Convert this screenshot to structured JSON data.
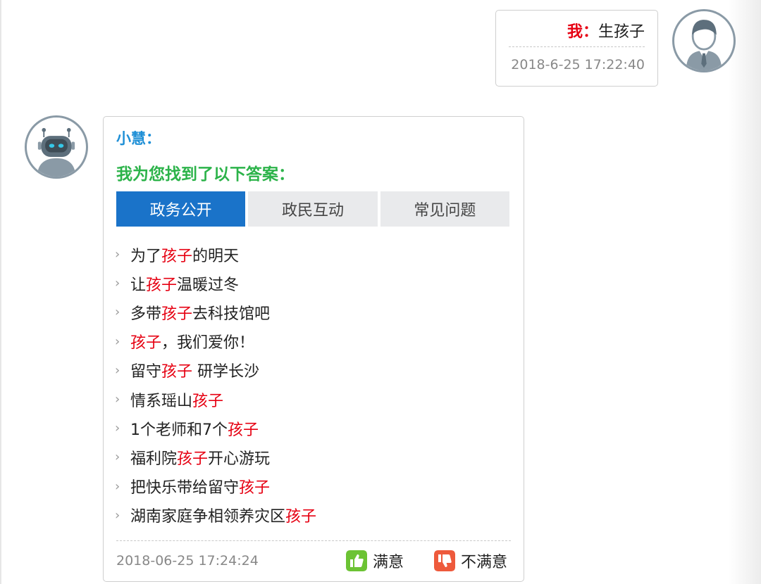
{
  "user_message": {
    "sender": "我：",
    "text": "生孩子",
    "time": "2018-6-25 17:22:40"
  },
  "bot_message": {
    "sender": "小慧：",
    "intro": "我为您找到了以下答案：",
    "tabs": [
      {
        "label": "政务公开",
        "active": true
      },
      {
        "label": "政民互动",
        "active": false
      },
      {
        "label": "常见问题",
        "active": false
      }
    ],
    "results": [
      {
        "before": "为了",
        "keyword": "孩子",
        "after": "的明天"
      },
      {
        "before": "让",
        "keyword": "孩子",
        "after": "温暖过冬"
      },
      {
        "before": "多带",
        "keyword": "孩子",
        "after": "去科技馆吧"
      },
      {
        "before": "",
        "keyword": "孩子",
        "after": "，我们爱你！"
      },
      {
        "before": "留守",
        "keyword": "孩子",
        "after": " 研学长沙"
      },
      {
        "before": "情系瑶山",
        "keyword": "孩子",
        "after": ""
      },
      {
        "before": "1个老师和7个",
        "keyword": "孩子",
        "after": ""
      },
      {
        "before": "福利院",
        "keyword": "孩子",
        "after": "开心游玩"
      },
      {
        "before": "把快乐带给留守",
        "keyword": "孩子",
        "after": ""
      },
      {
        "before": "湖南家庭争相领养灾区",
        "keyword": "孩子",
        "after": ""
      }
    ],
    "time": "2018-06-25 17:24:24",
    "satisfied_label": "满意",
    "unsatisfied_label": "不满意"
  },
  "icons": {
    "user_avatar": "user-avatar-icon",
    "bot_avatar": "robot-avatar-icon",
    "list_bullet": "chevron-right-icon",
    "satisfied": "thumbs-up-icon",
    "unsatisfied": "thumbs-down-icon"
  },
  "colors": {
    "user_name": "#e60012",
    "keyword_highlight": "#e60012",
    "bot_name": "#1e8fd6",
    "bot_intro": "#2cb34a",
    "active_tab": "#1a73c9",
    "satisfied_icon": "#6cc334",
    "unsatisfied_icon": "#ee5a3c"
  }
}
